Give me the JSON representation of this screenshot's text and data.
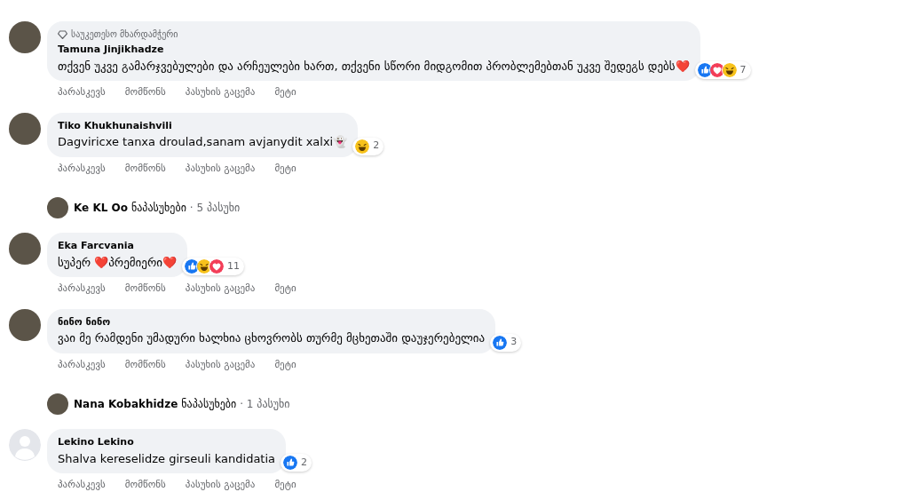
{
  "items": [
    {
      "kind": "comment",
      "avatar": {
        "kind": "photo"
      },
      "badge": "საუკეთესო მხარდამჭერი",
      "author": "Tamuna Jinjikhadze",
      "text": "თქვენ უკვე გამარჯვებულები და არჩეულები ხართ, თქვენი სწორი მიდგომით პრობლემებთან უკვე შედეგს დებს❤️",
      "reactions": [
        {
          "kind": "like"
        },
        {
          "kind": "love"
        },
        {
          "kind": "haha"
        }
      ],
      "reaction_count": "7",
      "actions": [
        "პარასკევს",
        "მომწონს",
        "პასუხის გაცემა",
        "მეტი"
      ]
    },
    {
      "kind": "comment",
      "avatar": {
        "kind": "photo"
      },
      "author": "Tiko Khukhunaishvili",
      "text": "Dagviricxe tanxa droulad,sanam avjanydit xalxi👻",
      "reactions": [
        {
          "kind": "haha"
        }
      ],
      "reaction_count": "2",
      "actions": [
        "პარასკევს",
        "მომწონს",
        "პასუხის გაცემა",
        "მეტი"
      ]
    },
    {
      "kind": "replies",
      "author": "Ke KL Oo",
      "label": "ნაპასუხები",
      "count": "· 5 პასუხი"
    },
    {
      "kind": "comment",
      "avatar": {
        "kind": "photo"
      },
      "author": "Eka Farcvania",
      "text": "სუპერ ❤️პრემიერი❤️",
      "reactions": [
        {
          "kind": "like"
        },
        {
          "kind": "haha"
        },
        {
          "kind": "love"
        }
      ],
      "reaction_count": "11",
      "actions": [
        "პარასკევს",
        "მომწონს",
        "პასუხის გაცემა",
        "მეტი"
      ]
    },
    {
      "kind": "comment",
      "avatar": {
        "kind": "photo"
      },
      "author": "ნინო ნინო",
      "text": "ვაი მე რამდენი უმადური ხალხია ცხოვრობს თურმე მცხეთაში დაუჯერებელია",
      "reactions": [
        {
          "kind": "like"
        }
      ],
      "reaction_count": "3",
      "actions": [
        "პარასკევს",
        "მომწონს",
        "პასუხის გაცემა",
        "მეტი"
      ]
    },
    {
      "kind": "replies",
      "author": "Nana Kobakhidze",
      "label": "ნაპასუხები",
      "count": "· 1 პასუხი"
    },
    {
      "kind": "comment",
      "avatar": {
        "kind": "default"
      },
      "author": "Lekino Lekino",
      "text": "Shalva kereselidze girseuli kandidatia",
      "reactions": [
        {
          "kind": "like"
        }
      ],
      "reaction_count": "2",
      "actions": [
        "პარასკევს",
        "მომწონს",
        "პასუხის გაცემა",
        "მეტი"
      ]
    }
  ]
}
